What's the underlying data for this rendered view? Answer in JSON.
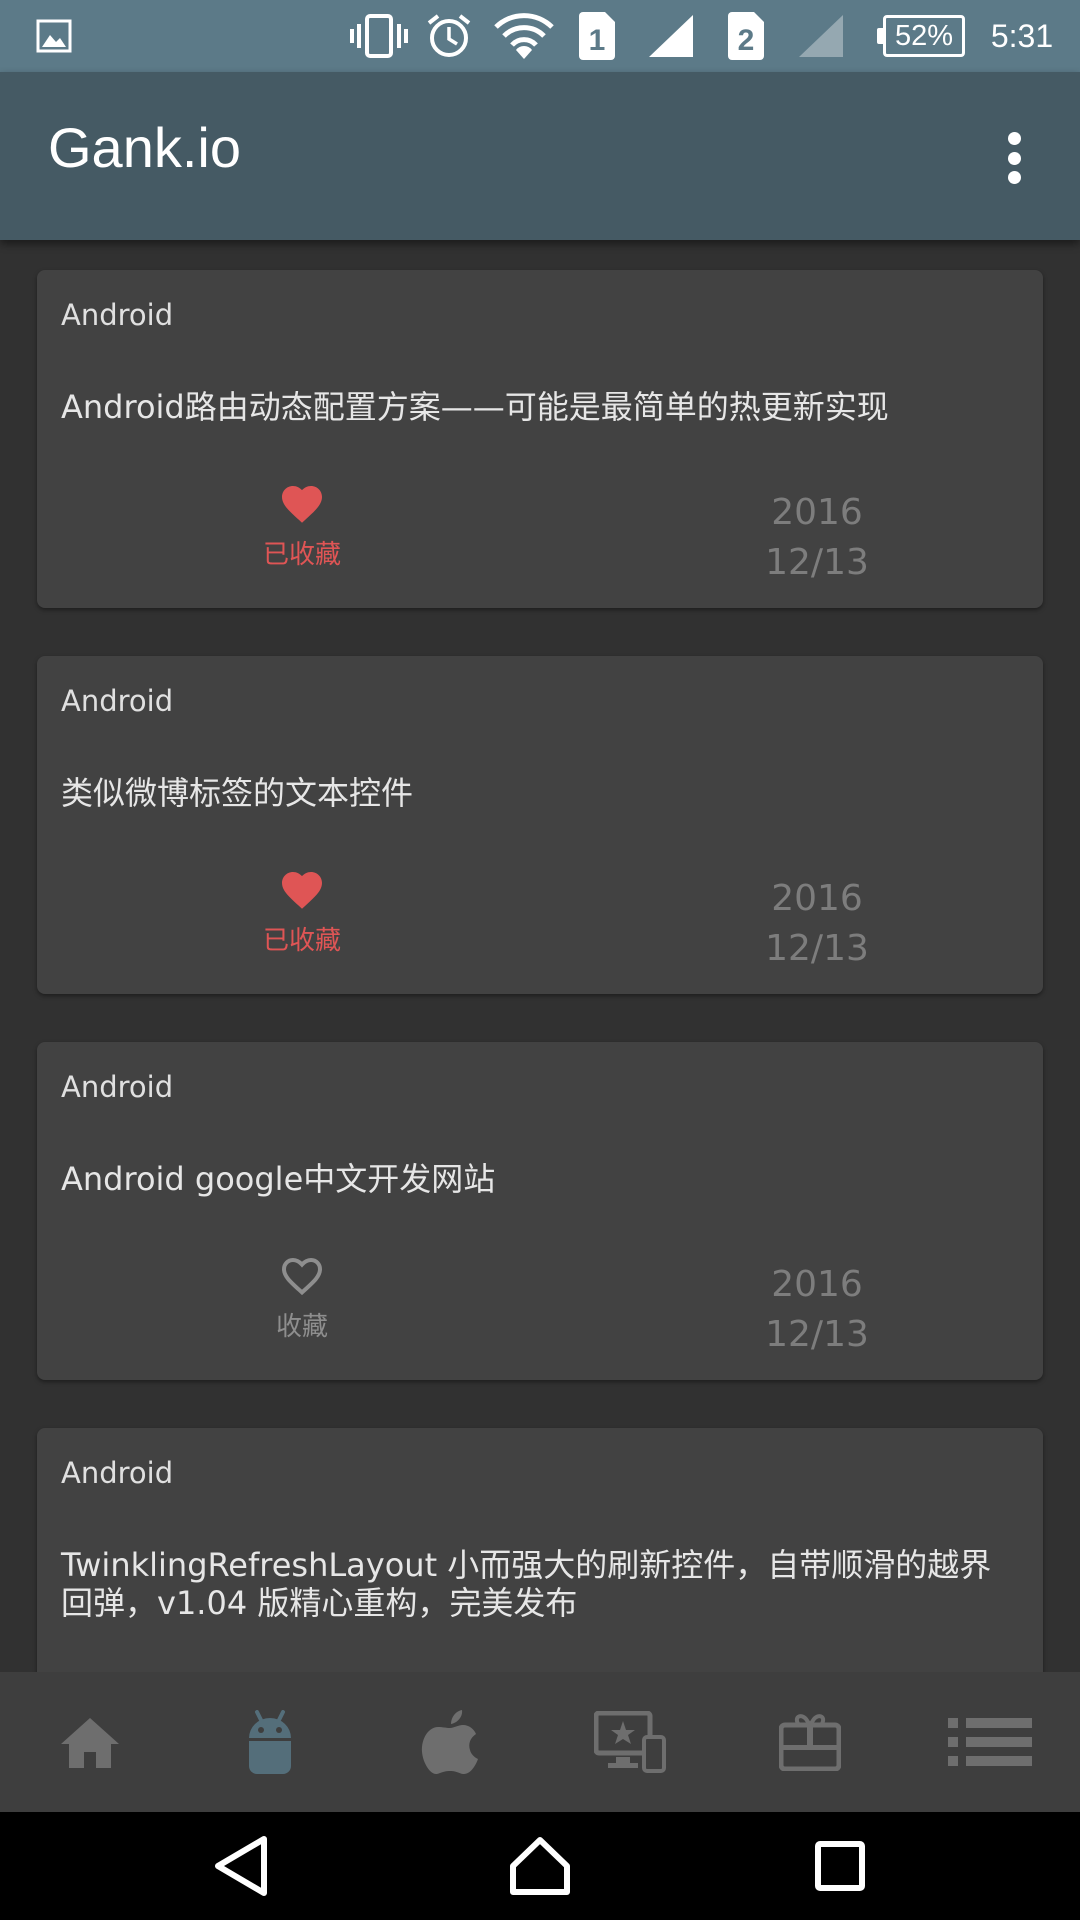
{
  "status_bar": {
    "battery": "52%",
    "time": "5:31",
    "sim1": "1",
    "sim2": "2",
    "icons": [
      "image-icon",
      "vibrate-icon",
      "alarm-icon",
      "wifi-icon",
      "signal-icon",
      "battery-icon"
    ]
  },
  "appbar": {
    "title": "Gank.io",
    "menu_icon": "more-vert-icon"
  },
  "cards": [
    {
      "category": "Android",
      "title": "Android路由动态配置方案——可能是最简单的热更新实现",
      "favorited": true,
      "fav_label": "已收藏",
      "year": "2016",
      "date": "12/13"
    },
    {
      "category": "Android",
      "title": "类似微博标签的文本控件",
      "favorited": true,
      "fav_label": "已收藏",
      "year": "2016",
      "date": "12/13"
    },
    {
      "category": "Android",
      "title": "Android google中文开发网站",
      "favorited": false,
      "fav_label": "收藏",
      "year": "2016",
      "date": "12/13"
    },
    {
      "category": "Android",
      "title": "TwinklingRefreshLayout 小而强大的刷新控件，自带顺滑的越界回弹，v1.04 版精心重构，完美发布",
      "favorited": false,
      "fav_label": "",
      "year": "",
      "date": ""
    }
  ],
  "bottom_nav": {
    "items": [
      "home-icon",
      "android-icon",
      "apple-icon",
      "frontend-icon",
      "gift-icon",
      "list-icon"
    ],
    "selected": "android-icon"
  },
  "colors": {
    "status_bar": "#5c7a88",
    "app_bar": "#455a64",
    "background": "#313131",
    "card": "#424242",
    "favorite": "#df5555",
    "nav_selected": "#546e7a",
    "nav_default": "#6e6e6e"
  }
}
